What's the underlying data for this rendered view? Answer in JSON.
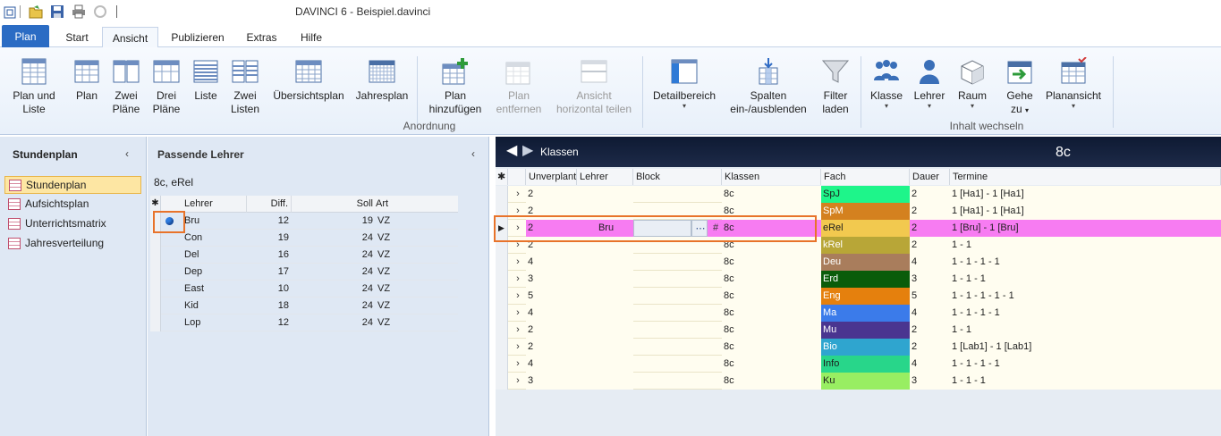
{
  "window": {
    "title": "DAVINCI 6 - Beispiel.davinci"
  },
  "ribbon_tabs": [
    "Plan",
    "Start",
    "Ansicht",
    "Publizieren",
    "Extras",
    "Hilfe"
  ],
  "ribbon": {
    "plan_und_liste": [
      "Plan und",
      "Liste"
    ],
    "plan": "Plan",
    "zwei_plaene": [
      "Zwei",
      "Pläne"
    ],
    "drei_plaene": [
      "Drei",
      "Pläne"
    ],
    "liste": "Liste",
    "zwei_listen": [
      "Zwei",
      "Listen"
    ],
    "uebersichtsplan": "Übersichtsplan",
    "jahresplan": "Jahresplan",
    "plan_hinzufuegen": [
      "Plan",
      "hinzufügen"
    ],
    "plan_entfernen": [
      "Plan",
      "entfernen"
    ],
    "ansicht_teilen": [
      "Ansicht",
      "horizontal teilen"
    ],
    "detailbereich": "Detailbereich",
    "spalten": [
      "Spalten",
      "ein-/ausblenden"
    ],
    "filter_laden": [
      "Filter",
      "laden"
    ],
    "klasse": "Klasse",
    "lehrer": "Lehrer",
    "raum": "Raum",
    "gehe_zu": [
      "Gehe",
      "zu"
    ],
    "planansicht": "Planansicht",
    "group_anordnung": "Anordnung",
    "group_inhalt": "Inhalt wechseln"
  },
  "nav": {
    "title": "Stundenplan",
    "items": [
      {
        "label": "Stundenplan",
        "selected": true
      },
      {
        "label": "Aufsichtsplan",
        "selected": false
      },
      {
        "label": "Unterrichtsmatrix",
        "selected": false
      },
      {
        "label": "Jahresverteilung",
        "selected": false
      }
    ]
  },
  "teachers_panel": {
    "title": "Passende Lehrer",
    "subtitle": "8c, eRel",
    "columns": [
      "Lehrer",
      "Diff.",
      "Soll",
      "Art"
    ],
    "rows": [
      {
        "lehrer": "Bru",
        "diff": "12",
        "soll": "19",
        "art": "VZ",
        "marked": true
      },
      {
        "lehrer": "Con",
        "diff": "19",
        "soll": "24",
        "art": "VZ"
      },
      {
        "lehrer": "Del",
        "diff": "16",
        "soll": "24",
        "art": "VZ"
      },
      {
        "lehrer": "Dep",
        "diff": "17",
        "soll": "24",
        "art": "VZ"
      },
      {
        "lehrer": "East",
        "diff": "10",
        "soll": "24",
        "art": "VZ"
      },
      {
        "lehrer": "Kid",
        "diff": "18",
        "soll": "24",
        "art": "VZ"
      },
      {
        "lehrer": "Lop",
        "diff": "12",
        "soll": "24",
        "art": "VZ"
      }
    ]
  },
  "lessons_panel": {
    "header_label": "Klassen",
    "header_value": "8c",
    "columns": [
      "Unverplant",
      "Lehrer",
      "Block",
      "Klassen",
      "Fach",
      "Dauer",
      "Termine"
    ],
    "rows": [
      {
        "unverplant": "2",
        "lehrer": "",
        "klassen": "8c",
        "fach": "SpJ",
        "fach_color": "#1ef58a",
        "dauer": "2",
        "termine": "1 [Ha1] - 1 [Ha1]"
      },
      {
        "unverplant": "2",
        "lehrer": "",
        "klassen": "8c",
        "fach": "SpM",
        "fach_color": "#d4811f",
        "dauer": "2",
        "termine": "1 [Ha1] - 1 [Ha1]"
      },
      {
        "unverplant": "2",
        "lehrer": "Bru",
        "klassen": "8c",
        "fach": "eRel",
        "fach_color": "#f2c94f",
        "dauer": "2",
        "termine": "1 [Bru] - 1 [Bru]",
        "selected": true
      },
      {
        "unverplant": "2",
        "lehrer": "",
        "klassen": "8c",
        "fach": "kRel",
        "fach_color": "#b8a637",
        "dauer": "2",
        "termine": "1 - 1"
      },
      {
        "unverplant": "4",
        "lehrer": "",
        "klassen": "8c",
        "fach": "Deu",
        "fach_color": "#a97d5c",
        "dauer": "4",
        "termine": "1 - 1 - 1 - 1"
      },
      {
        "unverplant": "3",
        "lehrer": "",
        "klassen": "8c",
        "fach": "Erd",
        "fach_color": "#0a5c0a",
        "dauer": "3",
        "termine": "1 - 1 - 1"
      },
      {
        "unverplant": "5",
        "lehrer": "",
        "klassen": "8c",
        "fach": "Eng",
        "fach_color": "#e5800d",
        "dauer": "5",
        "termine": "1 - 1 - 1 - 1 - 1"
      },
      {
        "unverplant": "4",
        "lehrer": "",
        "klassen": "8c",
        "fach": "Ma",
        "fach_color": "#3b7bea",
        "dauer": "4",
        "termine": "1 - 1 - 1 - 1"
      },
      {
        "unverplant": "2",
        "lehrer": "",
        "klassen": "8c",
        "fach": "Mu",
        "fach_color": "#4a3590",
        "dauer": "2",
        "termine": "1 - 1"
      },
      {
        "unverplant": "2",
        "lehrer": "",
        "klassen": "8c",
        "fach": "Bio",
        "fach_color": "#2fa5cf",
        "dauer": "2",
        "termine": "1 [Lab1] - 1 [Lab1]"
      },
      {
        "unverplant": "4",
        "lehrer": "",
        "klassen": "8c",
        "fach": "Info",
        "fach_color": "#28d68a",
        "dauer": "4",
        "termine": "1 - 1 - 1 - 1"
      },
      {
        "unverplant": "3",
        "lehrer": "",
        "klassen": "8c",
        "fach": "Ku",
        "fach_color": "#98ee62",
        "dauer": "3",
        "termine": "1 - 1 - 1"
      }
    ]
  },
  "colors": {
    "accent": "#2b6cc4",
    "selection": "#f77cf2",
    "highlight_box": "#e8732a"
  }
}
